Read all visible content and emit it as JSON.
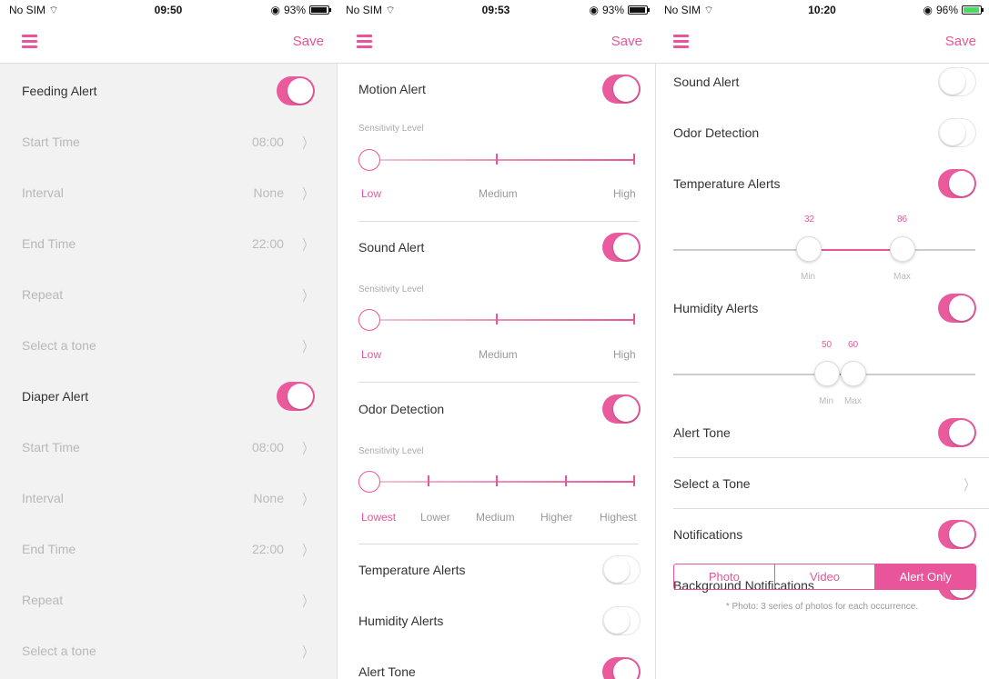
{
  "colors": {
    "accent": "#e8559a",
    "toggle_on": "#ea5b9e",
    "dim_text": "#b8b8b8"
  },
  "screens": [
    {
      "status": {
        "carrier": "No SIM",
        "time": "09:50",
        "battery": "93%"
      },
      "nav": {
        "menu_icon": "hamburger-icon",
        "save": "Save"
      },
      "rows": [
        {
          "label": "Feeding Alert",
          "toggle": true
        },
        {
          "label": "Start Time",
          "value": "08:00"
        },
        {
          "label": "Interval",
          "value": "None"
        },
        {
          "label": "End Time",
          "value": "22:00"
        },
        {
          "label": "Repeat",
          "value": ""
        },
        {
          "label": "Select a tone",
          "value": ""
        },
        {
          "label": "Diaper Alert",
          "toggle": true
        },
        {
          "label": "Start Time",
          "value": "08:00"
        },
        {
          "label": "Interval",
          "value": "None"
        },
        {
          "label": "End Time",
          "value": "22:00"
        },
        {
          "label": "Repeat",
          "value": ""
        },
        {
          "label": "Select a tone",
          "value": ""
        }
      ]
    },
    {
      "status": {
        "carrier": "No SIM",
        "time": "09:53",
        "battery": "93%"
      },
      "nav": {
        "menu_icon": "hamburger-icon",
        "save": "Save"
      },
      "motion": {
        "label": "Motion Alert",
        "toggle": true,
        "sensitivity_title": "Sensitivity Level",
        "levels": [
          "Low",
          "Medium",
          "High"
        ],
        "selected": "Low"
      },
      "sound": {
        "label": "Sound Alert",
        "toggle": true,
        "sensitivity_title": "Sensitivity Level",
        "levels": [
          "Low",
          "Medium",
          "High"
        ],
        "selected": "Low"
      },
      "odor": {
        "label": "Odor Detection",
        "toggle": true,
        "sensitivity_title": "Sensitivity Level",
        "levels": [
          "Lowest",
          "Lower",
          "Medium",
          "Higher",
          "Highest"
        ],
        "selected": "Lowest"
      },
      "temperature": {
        "label": "Temperature Alerts",
        "toggle": false
      },
      "humidity": {
        "label": "Humidity Alerts",
        "toggle": false
      },
      "alert_tone": {
        "label": "Alert Tone",
        "toggle": true
      }
    },
    {
      "status": {
        "carrier": "No SIM",
        "time": "10:20",
        "battery": "96%"
      },
      "nav": {
        "menu_icon": "hamburger-icon",
        "save": "Save"
      },
      "sound": {
        "label": "Sound Alert",
        "toggle": false
      },
      "odor": {
        "label": "Odor Detection",
        "toggle": false
      },
      "temperature": {
        "label": "Temperature Alerts",
        "toggle": true,
        "min": "32",
        "max": "86",
        "min_label": "Min",
        "max_label": "Max"
      },
      "humidity": {
        "label": "Humidity Alerts",
        "toggle": true,
        "min": "50",
        "max": "60",
        "min_label": "Min",
        "max_label": "Max"
      },
      "alert_tone": {
        "label": "Alert Tone",
        "toggle": true
      },
      "select_tone": {
        "label": "Select a Tone"
      },
      "notifications": {
        "label": "Notifications",
        "toggle": true
      },
      "background": {
        "label": "Background Notifications",
        "toggle": true
      },
      "capture_mode": {
        "options": [
          "Photo",
          "Video",
          "Alert Only"
        ],
        "selected": "Alert Only"
      },
      "footnote": "* Photo: 3 series of photos for each occurrence."
    }
  ]
}
